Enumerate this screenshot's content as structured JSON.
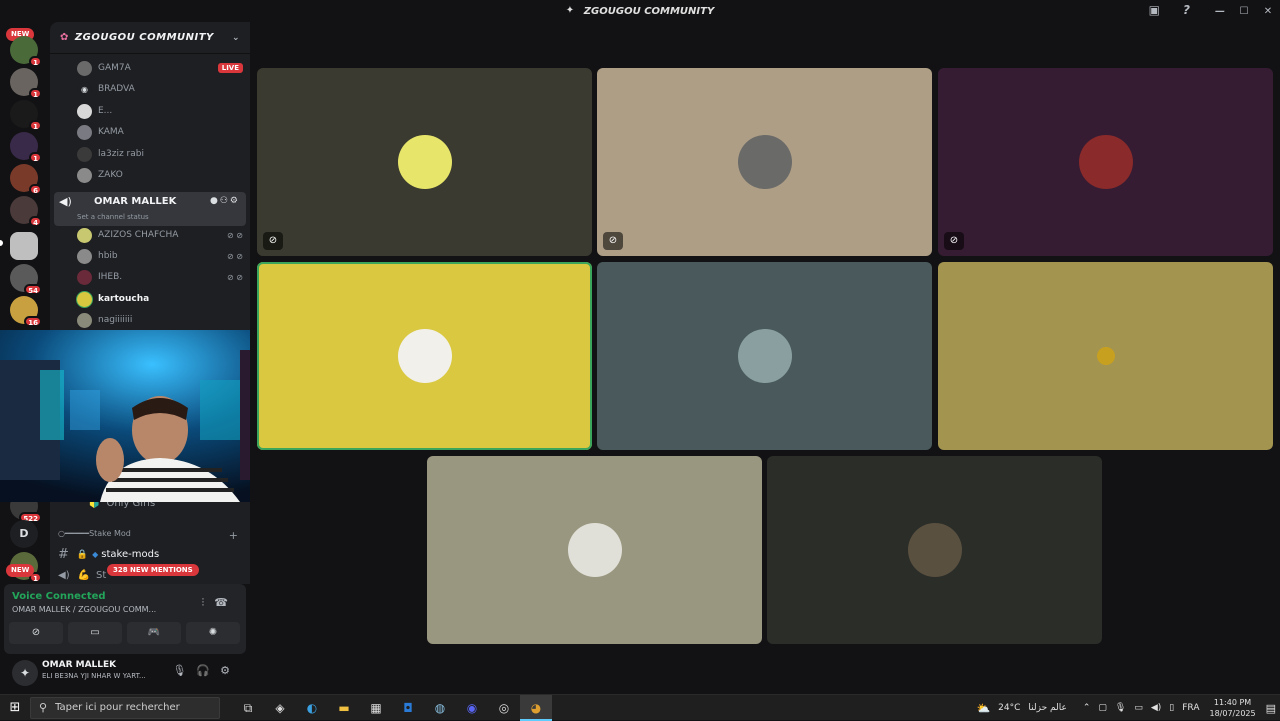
{
  "window": {
    "title": "ZGOUGOU COMMUNITY"
  },
  "server": {
    "name": "ZGOUGOU COMMUNITY"
  },
  "rail": {
    "new_top": "NEW",
    "new_bottom": "NEW",
    "badges": [
      "2",
      "1",
      "1",
      "1",
      "1",
      "6",
      "4",
      "54",
      "16",
      "522",
      "1"
    ],
    "dm_letter": "D"
  },
  "channel_users_above": [
    {
      "name": "GAM7A",
      "live": "LIVE"
    },
    {
      "name": "BRADVA"
    },
    {
      "name": "E..."
    },
    {
      "name": "KAMA"
    },
    {
      "name": "la3ziz rabi"
    },
    {
      "name": "ZAKO"
    }
  ],
  "active_channel": {
    "name": "OMAR MALLEK",
    "status": "Set a channel status"
  },
  "channel_users_below": [
    {
      "name": "AZIZOS CHAFCHA"
    },
    {
      "name": "hbib"
    },
    {
      "name": "IHEB."
    },
    {
      "name": "kartoucha"
    },
    {
      "name": "nagiiiiiii"
    }
  ],
  "more_channels": {
    "only_girls": "Only Girls",
    "category": "Stake Mod",
    "text_channel": "stake-mods",
    "partial_channel": "St",
    "mentions": "328 NEW MENTIONS"
  },
  "voice_panel": {
    "title": "Voice Connected",
    "location": "OMAR MALLEK / ZGOUGOU COMM..."
  },
  "user_panel": {
    "name": "OMAR MALLEK",
    "status": "ELI BE3NA YJI NHAR W YART..."
  },
  "tiles": [
    {
      "bg": "#3a3a30",
      "avatar": "#e8e66a",
      "muted": true
    },
    {
      "bg": "#ae9e86",
      "avatar": "#6a6a68",
      "muted": true
    },
    {
      "bg": "#361c33",
      "avatar": "#8a2a2a",
      "muted": true
    },
    {
      "bg": "#d9c840",
      "avatar": "#f2f0ea",
      "speaking": true
    },
    {
      "bg": "#4a5a5c",
      "avatar": "#8aa0a0"
    },
    {
      "bg": "#a39450",
      "avatar": "#c8a020"
    },
    {
      "bg": "#9a9780",
      "avatar": "#e0e0d8"
    },
    {
      "bg": "#2a2d28",
      "avatar": "#5a5040"
    }
  ],
  "taskbar": {
    "search_placeholder": "Taper ici pour rechercher",
    "weather": "24°C",
    "weather_text": "عالم حزلنا",
    "language": "FRA",
    "time": "11:40 PM",
    "date": "18/07/2025"
  },
  "colors": {
    "danger": "#da373c",
    "voice_green": "#23a55a",
    "speaking": "#3ba55c"
  }
}
